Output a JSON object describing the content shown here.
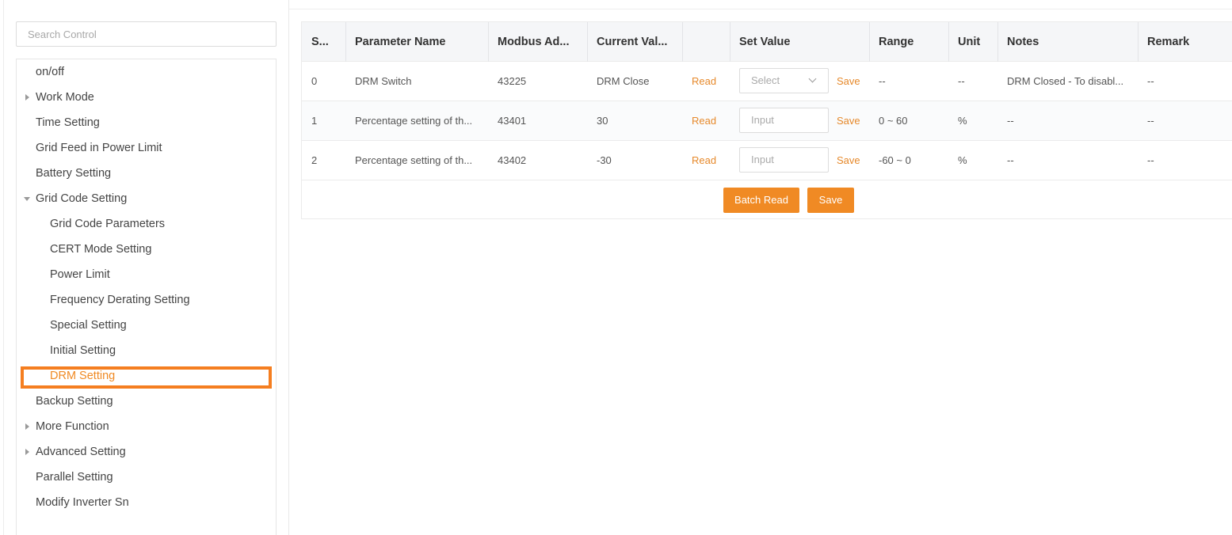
{
  "search": {
    "placeholder": "Search Control"
  },
  "tree": [
    {
      "label": "on/off"
    },
    {
      "label": "Work Mode"
    },
    {
      "label": "Time Setting"
    },
    {
      "label": "Grid Feed in Power Limit"
    },
    {
      "label": "Battery Setting"
    },
    {
      "label": "Grid Code Setting"
    },
    {
      "label": "Grid Code Parameters"
    },
    {
      "label": "CERT Mode Setting"
    },
    {
      "label": "Power Limit"
    },
    {
      "label": "Frequency Derating Setting"
    },
    {
      "label": "Special Setting"
    },
    {
      "label": "Initial Setting"
    },
    {
      "label": "DRM Setting"
    },
    {
      "label": "Backup Setting"
    },
    {
      "label": "More Function"
    },
    {
      "label": "Advanced Setting"
    },
    {
      "label": "Parallel Setting"
    },
    {
      "label": "Modify Inverter Sn"
    }
  ],
  "table": {
    "headers": [
      "S...",
      "Parameter Name",
      "Modbus Ad...",
      "Current Val...",
      "",
      "Set Value",
      "Range",
      "Unit",
      "Notes",
      "Remark"
    ],
    "rows": [
      {
        "sn": "0",
        "name": "DRM Switch",
        "modbus": "43225",
        "current": "DRM Close",
        "read": "Read",
        "set": "Select",
        "save": "Save",
        "range": "--",
        "unit": "--",
        "notes": "DRM Closed - To disabl...",
        "remark": "--"
      },
      {
        "sn": "1",
        "name": "Percentage setting of th...",
        "modbus": "43401",
        "current": "30",
        "read": "Read",
        "set": "Input",
        "save": "Save",
        "range": "0 ~ 60",
        "unit": "%",
        "notes": "--",
        "remark": "--"
      },
      {
        "sn": "2",
        "name": "Percentage setting of th...",
        "modbus": "43402",
        "current": "-30",
        "read": "Read",
        "set": "Input",
        "save": "Save",
        "range": "-60 ~ 0",
        "unit": "%",
        "notes": "--",
        "remark": "--"
      }
    ]
  },
  "actions": {
    "batch_read": "Batch Read",
    "save": "Save"
  },
  "colors": {
    "accent": "#f08a24",
    "highlight_box": "#f57e20"
  }
}
